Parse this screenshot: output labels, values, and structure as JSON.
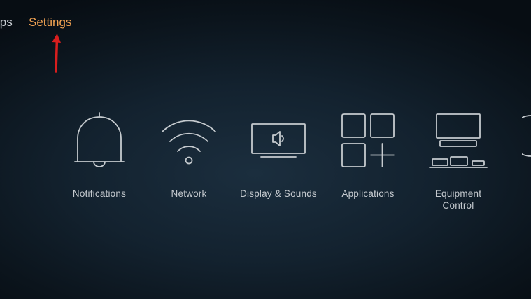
{
  "topnav": {
    "apps_label": "Apps",
    "settings_label": "Settings"
  },
  "tiles": [
    {
      "label": "Notifications",
      "icon": "bell-icon"
    },
    {
      "label": "Network",
      "icon": "wifi-icon"
    },
    {
      "label": "Display & Sounds",
      "icon": "display-sound-icon"
    },
    {
      "label": "Applications",
      "icon": "applications-grid-icon"
    },
    {
      "label_lines": [
        "Equipment",
        "Control"
      ],
      "icon": "equipment-control-icon"
    }
  ],
  "colors": {
    "selected_nav": "#f0a252",
    "text": "#c9ced3",
    "icon_stroke": "#c5cace",
    "annotation": "#d81e1e",
    "background": "#13222f"
  }
}
